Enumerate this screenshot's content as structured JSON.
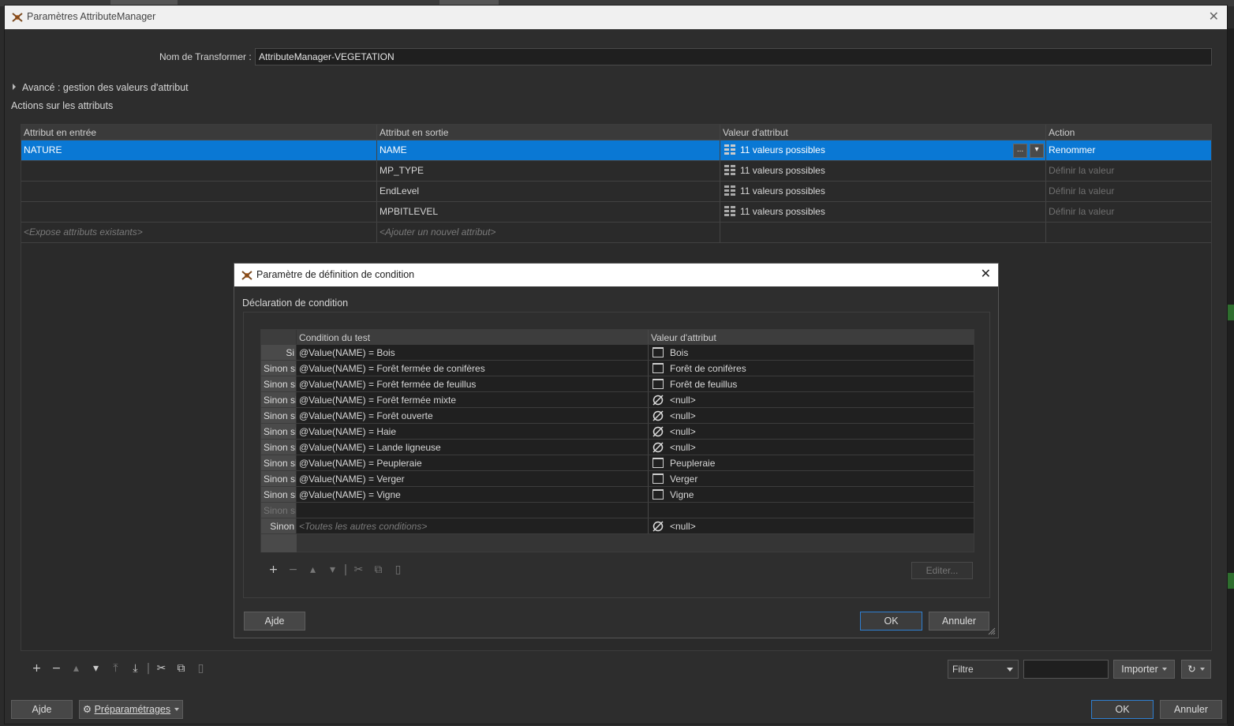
{
  "main_window": {
    "title": "Paramètres AttributeManager",
    "transformer_name_label": "Nom de Transformer :",
    "transformer_name_value": "AttributeManager-VEGETATION",
    "advanced_label": "Avancé : gestion des valeurs d'attribut",
    "actions_label": "Actions sur les attributs",
    "table": {
      "headers": [
        "Attribut en entrée",
        "Attribut en sortie",
        "Valeur d'attribut",
        "Action"
      ],
      "rows": [
        {
          "input": "NATURE",
          "output": "NAME",
          "value": "11 valeurs possibles",
          "action": "Renommer",
          "selected": true
        },
        {
          "input": "",
          "output": "MP_TYPE",
          "value": "11 valeurs possibles",
          "action": "Définir la valeur"
        },
        {
          "input": "",
          "output": "EndLevel",
          "value": "11 valeurs possibles",
          "action": "Définir la valeur"
        },
        {
          "input": "",
          "output": "MPBITLEVEL",
          "value": "11 valeurs possibles",
          "action": "Définir la valeur"
        }
      ],
      "placeholder_input": "<Expose attributs existants>",
      "placeholder_output": "<Ajouter un nouvel attribut>",
      "ellipsis_button": "..."
    },
    "filter_label": "Filtre",
    "import_button": "Importer",
    "help_button": "Ajde",
    "presets_button": "Préparamétrages",
    "ok_button": "OK",
    "cancel_button": "Annuler"
  },
  "dialog": {
    "title": "Paramètre de définition de condition",
    "declaration_label": "Déclaration de condition",
    "headers": [
      "Condition du test",
      "Valeur d'attribut"
    ],
    "rows": [
      {
        "prefix": "Si",
        "condition": "@Value(NAME) = Bois",
        "value": "Bois",
        "icon": "box"
      },
      {
        "prefix": "Sinon si",
        "condition": "@Value(NAME) = Forêt fermée de conifères",
        "value": "Forêt de conifères",
        "icon": "box"
      },
      {
        "prefix": "Sinon si",
        "condition": "@Value(NAME) = Forêt fermée de feuillus",
        "value": "Forêt de feuillus",
        "icon": "box"
      },
      {
        "prefix": "Sinon si",
        "condition": "@Value(NAME) = Forêt fermée mixte",
        "value": "<null>",
        "icon": "null"
      },
      {
        "prefix": "Sinon si",
        "condition": "@Value(NAME) = Forêt ouverte",
        "value": "<null>",
        "icon": "null"
      },
      {
        "prefix": "Sinon si",
        "condition": "@Value(NAME) = Haie",
        "value": "<null>",
        "icon": "null"
      },
      {
        "prefix": "Sinon si",
        "condition": "@Value(NAME) = Lande ligneuse",
        "value": "<null>",
        "icon": "null"
      },
      {
        "prefix": "Sinon si",
        "condition": "@Value(NAME) = Peupleraie",
        "value": "Peupleraie",
        "icon": "box"
      },
      {
        "prefix": "Sinon si",
        "condition": "@Value(NAME) = Verger",
        "value": "Verger",
        "icon": "box"
      },
      {
        "prefix": "Sinon si",
        "condition": "@Value(NAME) = Vigne",
        "value": "Vigne",
        "icon": "box"
      }
    ],
    "empty_prefix": "Sinon si",
    "else_prefix": "Sinon",
    "else_condition": "<Toutes les autres conditions>",
    "else_value": "<null>",
    "edit_button": "Editer...",
    "help_button": "Ajde",
    "ok_button": "OK",
    "cancel_button": "Annuler"
  }
}
